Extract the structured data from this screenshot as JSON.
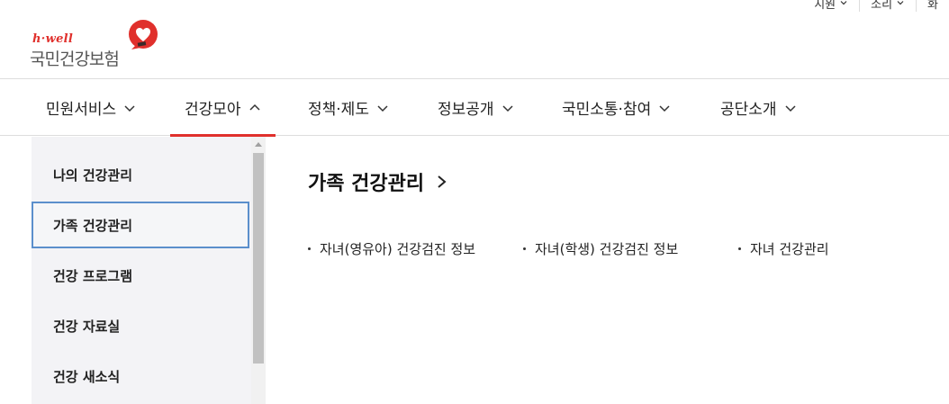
{
  "utility": {
    "items": [
      {
        "label": "지원"
      },
      {
        "label": "소리"
      },
      {
        "label": "화"
      }
    ]
  },
  "logo": {
    "brand": "h·well",
    "name": "국민건강보험",
    "heart_color": "#e0302c"
  },
  "gnb": {
    "items": [
      {
        "label": "민원서비스",
        "state": "collapsed"
      },
      {
        "label": "건강모아",
        "state": "expanded"
      },
      {
        "label": "정책·제도",
        "state": "collapsed"
      },
      {
        "label": "정보공개",
        "state": "collapsed"
      },
      {
        "label": "국민소통·참여",
        "state": "collapsed"
      },
      {
        "label": "공단소개",
        "state": "collapsed"
      }
    ],
    "active_color": "#e0302c"
  },
  "submenu": {
    "items": [
      {
        "label": "나의 건강관리"
      },
      {
        "label": "가족 건강관리"
      },
      {
        "label": "건강 프로그램"
      },
      {
        "label": "건강 자료실"
      },
      {
        "label": "건강 새소식"
      }
    ],
    "selected_index": 1,
    "selected_border_color": "#5b8fcc"
  },
  "content": {
    "title": "가족 건강관리",
    "links": [
      {
        "label": "자녀(영유아) 건강검진 정보"
      },
      {
        "label": "자녀(학생) 건강검진 정보"
      },
      {
        "label": "자녀 건강관리"
      }
    ]
  }
}
